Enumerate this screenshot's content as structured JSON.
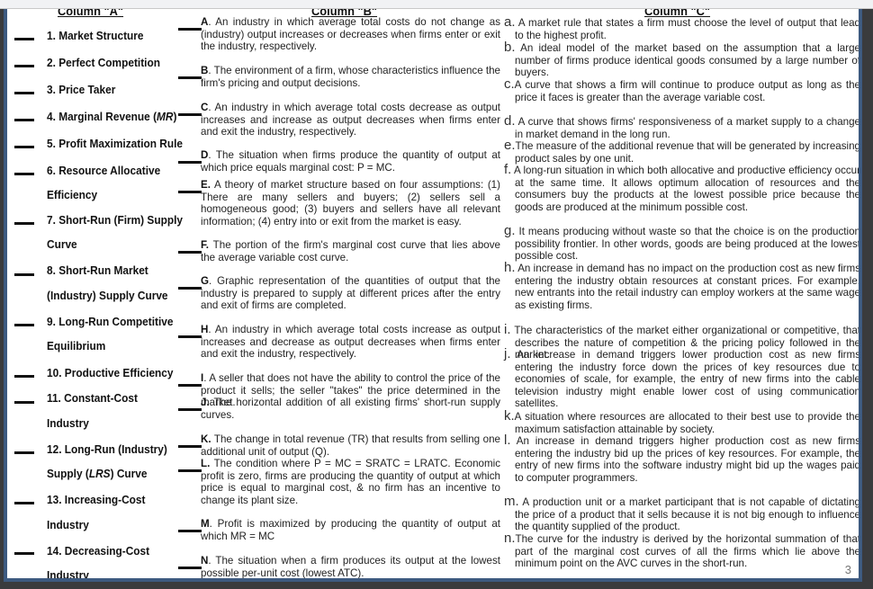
{
  "document": {
    "page_number": "3",
    "column_a": {
      "header": "Column \"A\"",
      "terms": [
        {
          "line1": "1. Market Structure",
          "line2": ""
        },
        {
          "line1": "2. Perfect Competition",
          "line2": ""
        },
        {
          "line1": "3. Price Taker",
          "line2": ""
        },
        {
          "line1": "4. Marginal Revenue (MR)",
          "line2": ""
        },
        {
          "line1": "5. Profit Maximization Rule",
          "line2": ""
        },
        {
          "line1": "6. Resource Allocative",
          "line2": "Efficiency"
        },
        {
          "line1": "7. Short-Run (Firm) Supply",
          "line2": "Curve"
        },
        {
          "line1": "8. Short-Run Market",
          "line2": "(Industry) Supply Curve"
        },
        {
          "line1": "9. Long-Run Competitive",
          "line2": "Equilibrium"
        },
        {
          "line1": "10. Productive Efficiency",
          "line2": ""
        },
        {
          "line1": "11. Constant-Cost",
          "line2": "Industry"
        },
        {
          "line1": "12. Long-Run (Industry)",
          "line2": "Supply  (LRS) Curve"
        },
        {
          "line1": "13. Increasing-Cost",
          "line2": "Industry"
        },
        {
          "line1": "14. Decreasing-Cost",
          "line2": "Industry"
        }
      ]
    },
    "column_b": {
      "header": "Column \"B\"",
      "definitions": [
        {
          "letter": "A",
          "text": ". An industry in which average total costs do not change as (industry) output increases or decreases when firms enter or exit the industry, respectively."
        },
        {
          "letter": "B",
          "text": ". The environment of a firm, whose characteristics influence the firm's pricing and output decisions."
        },
        {
          "letter": "C",
          "text": ". An industry in which average total costs decrease as output increases and increase as output decreases when firms enter and exit the industry, respectively."
        },
        {
          "letter": "D",
          "text": ". The situation when firms produce the quantity of output at which price equals marginal cost: P = MC."
        },
        {
          "letter": "E.",
          "text": " A theory of market structure based on four assumptions: (1) There are many sellers and buyers; (2) sellers sell a homogeneous good; (3) buyers and sellers have all relevant information; (4) entry into or exit from the market is easy."
        },
        {
          "letter": "F.",
          "text": " The portion of the firm's marginal cost curve that lies above the average variable cost curve."
        },
        {
          "letter": "G",
          "text": ". Graphic representation of the quantities of output that the industry is prepared to supply at different prices after the entry and exit of firms are completed."
        },
        {
          "letter": "H",
          "text": ". An industry in which average total costs increase as output increases and decrease as output decreases when firms enter and exit the industry, respectively."
        },
        {
          "letter": "I",
          "text": ". A seller that does not have the ability to control the price of the product it sells; the seller \"takes\" the price determined in the market."
        },
        {
          "letter": "J.",
          "text": " The horizontal addition of all existing firms' short-run supply curves."
        },
        {
          "letter": "K.",
          "text": " The change in total revenue (TR) that results from selling one additional unit of output (Q)."
        },
        {
          "letter": "L.",
          "text": " The condition where P = MC = SRATC = LRATC. Economic profit is zero, firms are producing the quantity of output at which price is equal to marginal cost, & no firm has an incentive to change its plant size."
        },
        {
          "letter": "M",
          "text": ". Profit is maximized by producing the quantity of output at which MR = MC"
        },
        {
          "letter": "N",
          "text": ". The situation when a firm produces its output at the lowest possible per-unit cost (lowest ATC)."
        }
      ]
    },
    "column_c": {
      "header": "Column \"C\"",
      "definitions": [
        {
          "letter": "a.",
          "text": " A market rule that states a firm must choose the level of output that lead to the highest profit."
        },
        {
          "letter": "b.",
          "text": " An ideal model of the market based on the assumption that a large number of firms produce identical goods consumed by a large number of  buyers."
        },
        {
          "letter": "c.",
          "text": "A curve that shows a firm will continue to produce output as long as  the price it faces is greater than the average variable cost."
        },
        {
          "letter": "d.",
          "text": " A curve that shows firms' responsiveness of  a market supply to a change in market demand in the long run."
        },
        {
          "letter": "e.",
          "text": "The measure of the additional revenue that will be generated by increasing product sales by one unit."
        },
        {
          "letter": "f.",
          "text": " A long-run situation in which both allocative and productive efficiency occur at the same time. It allows optimum allocation of resources and the consumers buy the products at the lowest possible price because the goods are produced at the minimum possible cost."
        },
        {
          "letter": "g.",
          "text": " It means producing without waste so that the choice is on the production possibility frontier. In other words, goods are being produced at the lowest possible cost."
        },
        {
          "letter": "h.",
          "text": " An increase in demand has no impact on the production cost as new firms entering the industry obtain resources at constant prices. For example, new entrants into the retail industry can employ workers at the same wage as existing firms."
        },
        {
          "letter": "i.",
          "text": " The characteristics of the market either organizational or competitive, that describes the nature of competition & the pricing policy followed in the market."
        },
        {
          "letter": "j.",
          "text": " An increase in demand triggers lower production cost as new firms entering the industry force down the prices of key resources due to  economies of scale, for example, the entry of new firms into the cable television industry might enable lower cost of using communication satellites."
        },
        {
          "letter": "k.",
          "text": "A situation where resources are allocated to their best use to provide the maximum satisfaction attainable by society."
        },
        {
          "letter": "l.",
          "text": " An increase in demand triggers higher production cost  as new firms entering the industry bid up the prices of key resources. For example, the entry of new firms into the software industry might bid up the wages paid to computer programmers."
        },
        {
          "letter": "m.",
          "text": " A production unit or a market participant that is not capable of dictating the price of a product that it sells because it is not big enough to influence the quantity supplied of the product."
        },
        {
          "letter": "n.",
          "text": "The  curve for the industry is derived by the horizontal summation of that part of the marginal cost curves of all the firms which lie above the minimum point on the AVC curves in the short-run."
        }
      ]
    }
  }
}
